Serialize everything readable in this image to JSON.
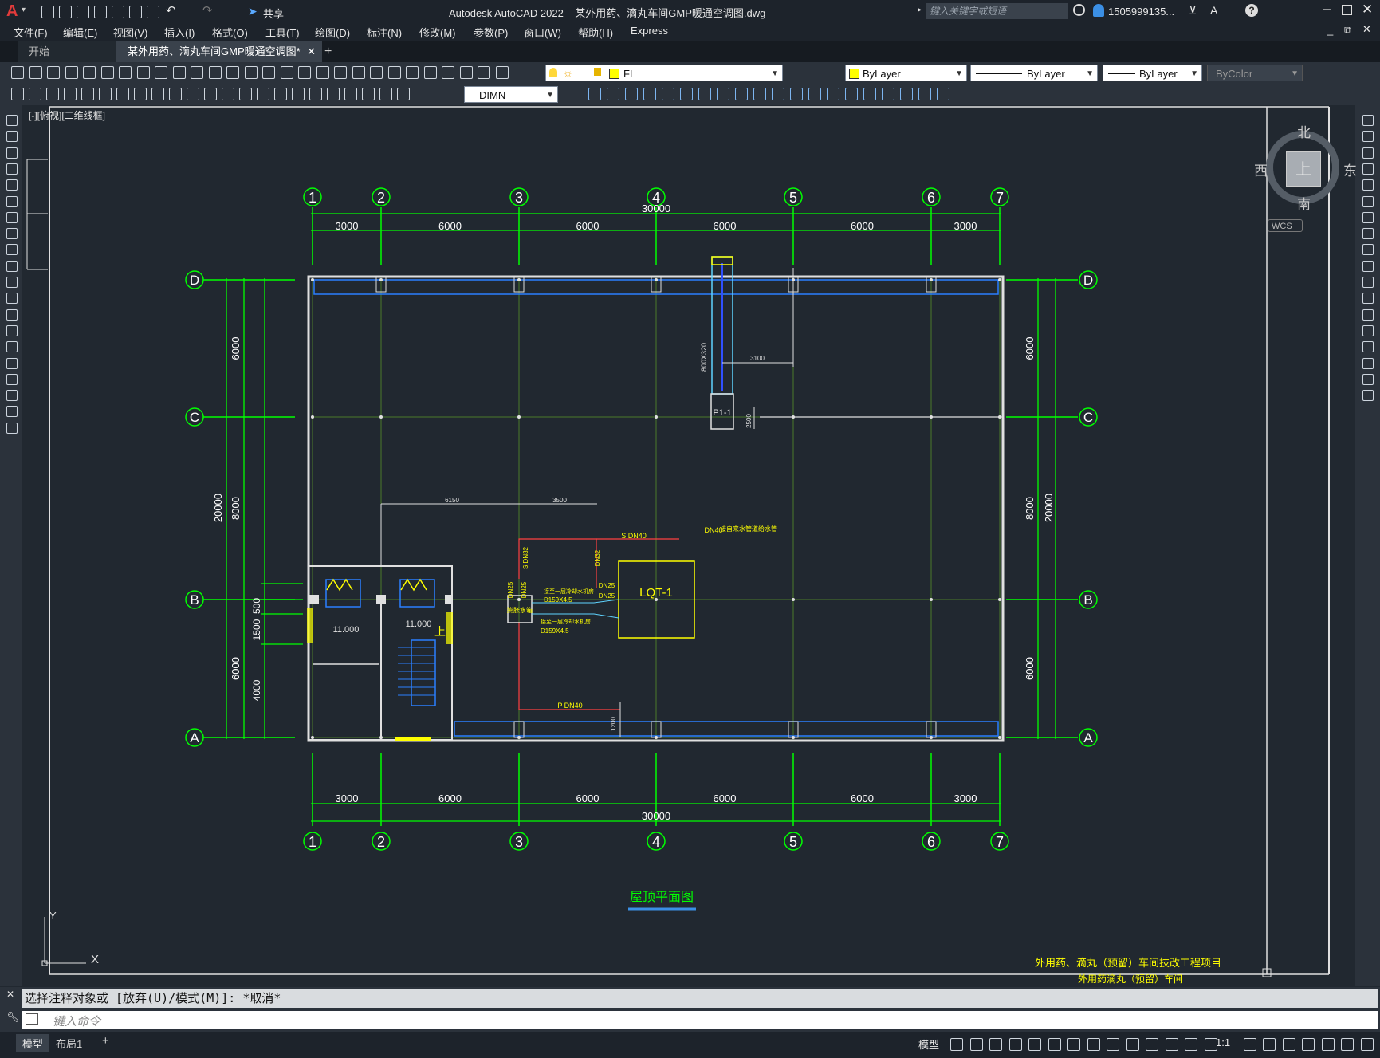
{
  "app": {
    "title": "Autodesk AutoCAD 2022    某外用药、滴丸车间GMP暖通空调图.dwg",
    "share_label": "共享",
    "search_placeholder": "键入关键字或短语",
    "user_label": "1505999135...",
    "logo_letter": "A"
  },
  "menu": [
    "文件(F)",
    "编辑(E)",
    "视图(V)",
    "插入(I)",
    "格式(O)",
    "工具(T)",
    "绘图(D)",
    "标注(N)",
    "修改(M)",
    "参数(P)",
    "窗口(W)",
    "帮助(H)",
    "Express"
  ],
  "tabs": {
    "start": "开始",
    "doc": "某外用药、滴丸车间GMP暖通空调图*",
    "add": "+"
  },
  "toolbar": {
    "layer_value": "FL",
    "color_value": "ByLayer",
    "linetype_value": "ByLayer",
    "lineweight_value": "ByLayer",
    "plotstyle_value": "ByColor",
    "dimstyle_value": "DIMN"
  },
  "viewport": {
    "label": "[-][俯视][二维线框]"
  },
  "viewcube": {
    "north": "北",
    "south": "南",
    "east": "东",
    "west": "西",
    "top": "上",
    "wcs": "WCS"
  },
  "drawing": {
    "col_grid": [
      "1",
      "2",
      "3",
      "4",
      "5",
      "6",
      "7"
    ],
    "row_grid": [
      "D",
      "C",
      "B",
      "A"
    ],
    "top_dims": [
      "3000",
      "6000",
      "6000",
      "6000",
      "6000",
      "3000"
    ],
    "total_x": "30000",
    "left_dims": [
      "6000",
      "8000",
      "6000"
    ],
    "total_y": "20000",
    "left_small_dims": [
      "500",
      "1500",
      "4000"
    ],
    "right_dims": [
      "6000",
      "8000",
      "6000"
    ],
    "equipment_lqt": "LQT-1",
    "equipment_p": "P1-1",
    "elev1": "11.000",
    "elev2": "11.000",
    "stair_up": "上",
    "duct_size": "800X320",
    "dim_3100": "3100",
    "dim_2500": "2500",
    "dim_6150": "6150",
    "dim_3500": "3500",
    "dim_1200": "1200",
    "pipe_s40": "S DN40",
    "pipe_p40": "P DN40",
    "pipe_dn32a": "S DN32",
    "pipe_dn32b": "DN32",
    "pipe_dn25a": "DN25",
    "pipe_dn25b": "DN25",
    "pipe_dn25c": "DN25",
    "pipe_dn25d": "DN25",
    "note_top": "接自来水管道给水管",
    "note_top2": "DN40",
    "note_r1": "接至一层冷却水机房",
    "note_r1b": "D159X4.5",
    "note_r2": "接至一层冷却水机房",
    "note_r2b": "D159X4.5",
    "note_box": "膨胀水箱",
    "plan_title": "屋顶平面图",
    "title_block_1": "外用药、滴丸（预留）车间技改工程项目",
    "title_block_2": "外用药滴丸（预留）车间"
  },
  "command": {
    "history": "选择注释对象或 [放弃(U)/模式(M)]: *取消*",
    "placeholder": "键入命令"
  },
  "status": {
    "model_tab": "模型",
    "layout_tab": "布局1",
    "add_tab": "+",
    "model_btn": "模型",
    "scale": "1:1"
  },
  "colors": {
    "grid_green": "#00ff00",
    "wall_white": "#e0e0e0",
    "duct_blue": "#2a7fff",
    "pipe_red": "#ff4040",
    "equip_yellow": "#ffff00",
    "accent_blue": "#3b8fe5"
  }
}
